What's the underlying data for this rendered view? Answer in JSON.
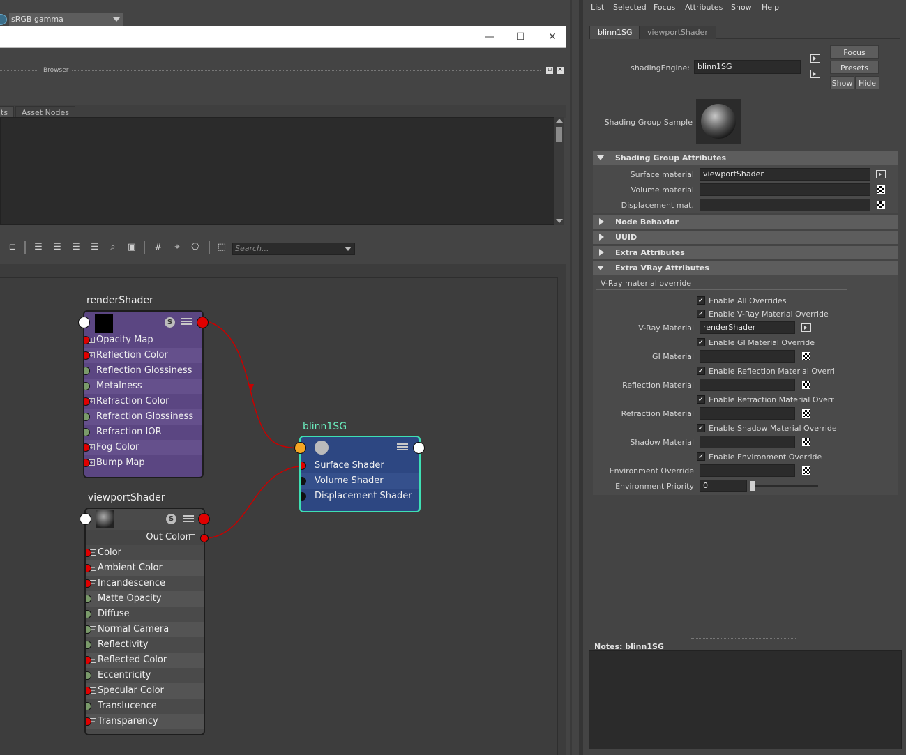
{
  "gamma": {
    "value": "sRGB gamma"
  },
  "window": {
    "minimize": "—",
    "maximize": "☐",
    "close": "✕"
  },
  "browser": {
    "label": "Browser",
    "tabs": [
      "ts",
      "Asset Nodes"
    ]
  },
  "toolbar": {
    "search_placeholder": "Search..."
  },
  "nodes": {
    "render": {
      "title": "renderShader",
      "badge": "S",
      "rows": [
        {
          "label": "Opacity Map",
          "port": "red",
          "plus": true
        },
        {
          "label": "Reflection Color",
          "port": "red",
          "plus": true
        },
        {
          "label": "Reflection Glossiness",
          "port": "green",
          "plus": false
        },
        {
          "label": "Metalness",
          "port": "green",
          "plus": false
        },
        {
          "label": "Refraction Color",
          "port": "red",
          "plus": true
        },
        {
          "label": "Refraction Glossiness",
          "port": "green",
          "plus": false
        },
        {
          "label": "Refraction IOR",
          "port": "green",
          "plus": false
        },
        {
          "label": "Fog Color",
          "port": "red",
          "plus": true
        },
        {
          "label": "Bump Map",
          "port": "red",
          "plus": true
        }
      ]
    },
    "blinn": {
      "title": "blinn1SG",
      "rows": [
        {
          "label": "Surface Shader",
          "port": "red"
        },
        {
          "label": "Volume Shader",
          "port": "black"
        },
        {
          "label": "Displacement Shader",
          "port": "black"
        }
      ]
    },
    "viewport": {
      "title": "viewportShader",
      "badge": "S",
      "out_label": "Out Color",
      "rows": [
        {
          "label": "Color",
          "port": "red",
          "plus": true
        },
        {
          "label": "Ambient Color",
          "port": "red",
          "plus": true
        },
        {
          "label": "Incandescence",
          "port": "red",
          "plus": true
        },
        {
          "label": "Matte Opacity",
          "port": "green",
          "plus": false
        },
        {
          "label": "Diffuse",
          "port": "green",
          "plus": false
        },
        {
          "label": "Normal Camera",
          "port": "green",
          "plus": true
        },
        {
          "label": "Reflectivity",
          "port": "green",
          "plus": false
        },
        {
          "label": "Reflected Color",
          "port": "red",
          "plus": true
        },
        {
          "label": "Eccentricity",
          "port": "green",
          "plus": false
        },
        {
          "label": "Specular Color",
          "port": "red",
          "plus": true
        },
        {
          "label": "Translucence",
          "port": "green",
          "plus": false
        },
        {
          "label": "Transparency",
          "port": "red",
          "plus": true
        }
      ]
    }
  },
  "ae": {
    "menu": [
      "List",
      "Selected",
      "Focus",
      "Attributes",
      "Show",
      "Help"
    ],
    "tabs": [
      "blinn1SG",
      "viewportShader"
    ],
    "engine_label": "shadingEngine:",
    "engine_value": "blinn1SG",
    "buttons": {
      "focus": "Focus",
      "presets": "Presets",
      "show": "Show",
      "hide": "Hide"
    },
    "sample_label": "Shading Group Sample",
    "sections": {
      "sga": "Shading Group Attributes",
      "node_behavior": "Node Behavior",
      "uuid": "UUID",
      "extra": "Extra Attributes",
      "vray": "Extra VRay Attributes"
    },
    "sga_rows": [
      {
        "label": "Surface material",
        "value": "viewportShader"
      },
      {
        "label": "Volume material",
        "value": ""
      },
      {
        "label": "Displacement mat.",
        "value": ""
      }
    ],
    "vray_group": "V-Ray material override",
    "vray_rows": {
      "enable_all": "Enable All Overrides",
      "enable_vray": "Enable V-Ray Material Override",
      "vray_mat_label": "V-Ray Material",
      "vray_mat_value": "renderShader",
      "enable_gi": "Enable GI Material Override",
      "gi_label": "GI Material",
      "enable_refl": "Enable Reflection Material Override",
      "refl_label": "Reflection Material",
      "enable_refr": "Enable Refraction Material Override",
      "refr_label": "Refraction Material",
      "enable_shadow": "Enable Shadow Material Override",
      "shadow_label": "Shadow Material",
      "enable_env": "Enable Environment Override",
      "env_label": "Environment Override",
      "env_prio_label": "Environment Priority",
      "env_prio_value": "0"
    },
    "notes_label": "Notes:  blinn1SG"
  }
}
